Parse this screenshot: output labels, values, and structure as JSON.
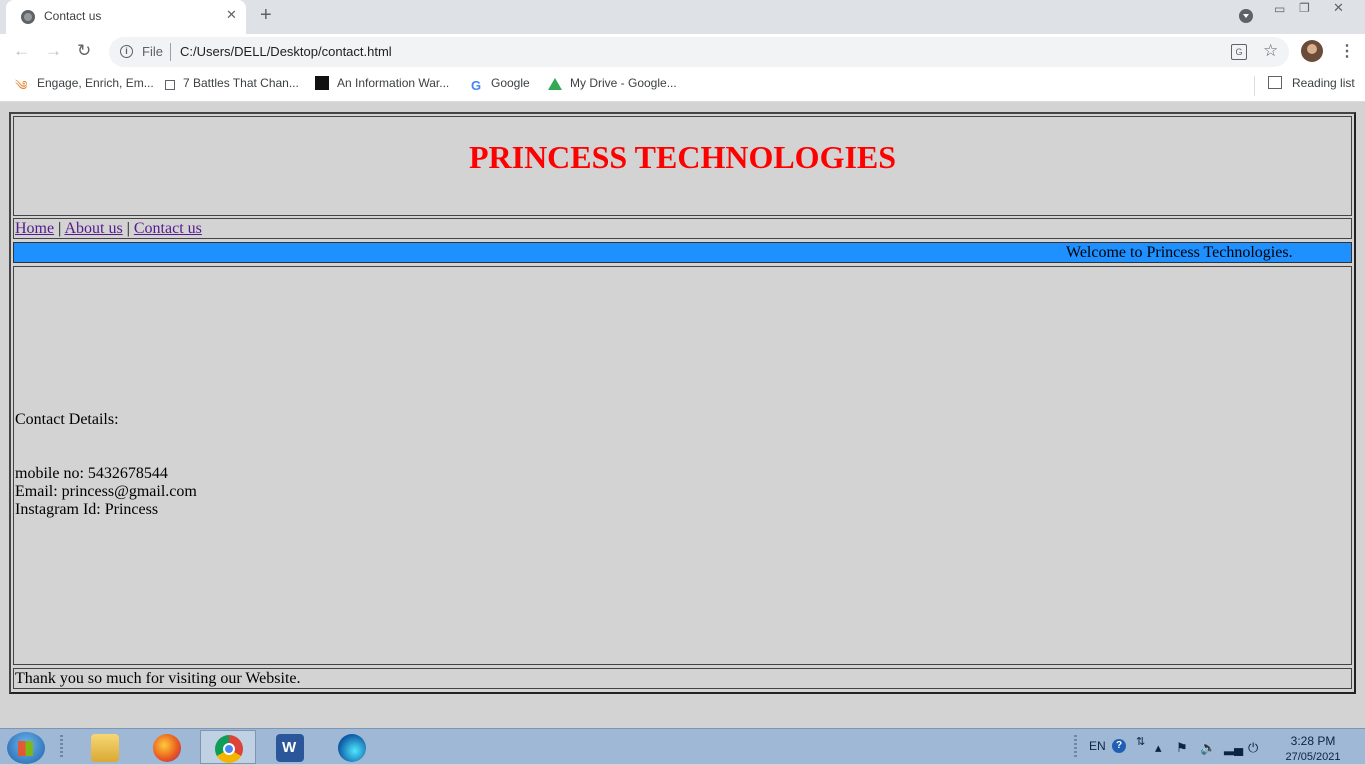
{
  "browser": {
    "tab_title": "Contact us",
    "url_scheme": "File",
    "url": "C:/Users/DELL/Desktop/contact.html",
    "bookmarks": [
      {
        "label": "Engage, Enrich, Em...",
        "icon": "flame-icon"
      },
      {
        "label": "7 Battles That Chan...",
        "icon": "grid-icon"
      },
      {
        "label": "An Information War...",
        "icon": "page-icon"
      },
      {
        "label": "Google",
        "icon": "google-icon"
      },
      {
        "label": "My Drive - Google...",
        "icon": "drive-icon"
      }
    ],
    "reading_list": "Reading list"
  },
  "page": {
    "title": "PRINCESS TECHNOLOGIES",
    "nav": {
      "home": "Home",
      "about": "About us",
      "contact": "Contact us",
      "separator": "|"
    },
    "marquee": "Welcome to Princess Technologies.",
    "contact": {
      "heading": "Contact Details:",
      "mobile": "mobile no: 5432678544",
      "email": "Email: princess@gmail.com",
      "instagram": "Instagram Id: Princess"
    },
    "footer": "Thank you so much for visiting our Website.",
    "colors": {
      "title": "#ff0000",
      "marquee_bg": "#1e90ff",
      "page_bg": "#d3d3d3"
    }
  },
  "taskbar": {
    "language": "EN",
    "time": "3:28 PM",
    "date": "27/05/2021"
  }
}
